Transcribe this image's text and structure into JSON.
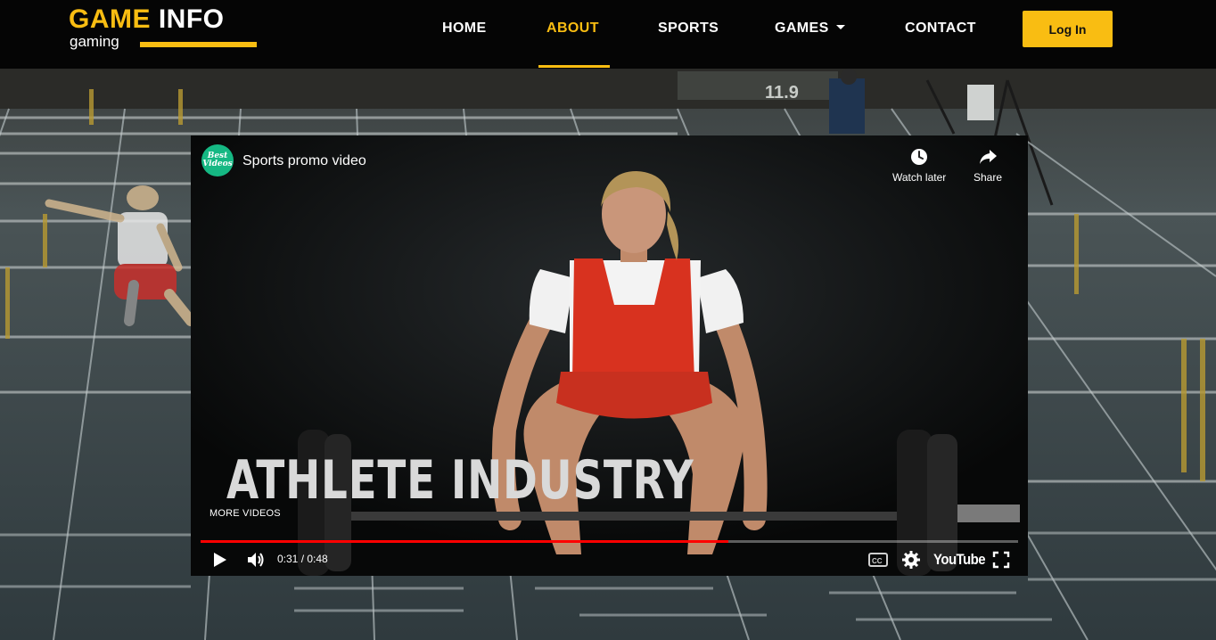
{
  "brand": {
    "word1": "GAME",
    "word2": "INFO",
    "subtitle": "gaming",
    "accent_color": "#f9bd12"
  },
  "nav": {
    "items": [
      {
        "label": "HOME",
        "active": false
      },
      {
        "label": "ABOUT",
        "active": true
      },
      {
        "label": "SPORTS",
        "active": false
      },
      {
        "label": "GAMES",
        "active": false,
        "has_dropdown": true
      },
      {
        "label": "CONTACT",
        "active": false
      }
    ],
    "login_label": "Log In"
  },
  "video": {
    "channel_avatar_text": "Best Videos",
    "title": "Sports promo video",
    "actions": [
      {
        "icon": "clock-icon",
        "label": "Watch later"
      },
      {
        "icon": "share-icon",
        "label": "Share"
      }
    ],
    "overlay_text": "ATHLETE INDUSTRY",
    "more_videos_label": "MORE VIDEOS",
    "time_display": "0:31 / 0:48",
    "progress": 0.646,
    "progress_color": "#ff0000",
    "platform_label": "YouTube",
    "controls": [
      "play-icon",
      "volume-icon",
      "captions-icon",
      "settings-icon",
      "fullscreen-icon"
    ]
  },
  "background": {
    "scoreboard_text": "11.9"
  }
}
